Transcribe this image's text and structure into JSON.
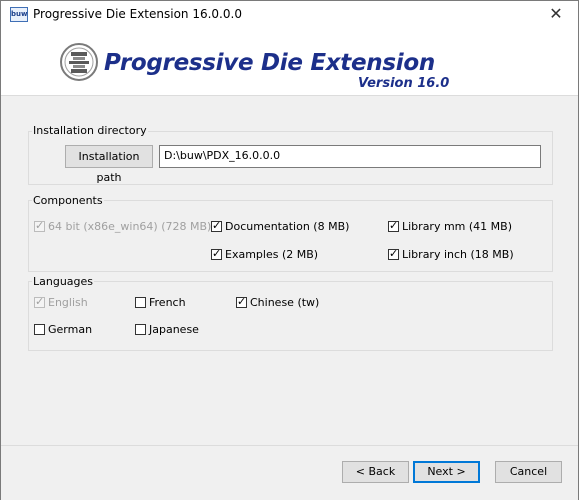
{
  "window": {
    "title": "Progressive Die Extension 16.0.0.0",
    "icon_text": "buw",
    "close_glyph": "✕"
  },
  "banner": {
    "title": "Progressive Die Extension",
    "version": "Version 16.0",
    "brand_color": "#1c2f8a"
  },
  "install": {
    "group_label": "Installation directory",
    "path_button": "Installation path",
    "path_value": "D:\\buw\\PDX_16.0.0.0"
  },
  "components": {
    "group_label": "Components",
    "items": [
      {
        "label": "64 bit (x86e_win64) (728 MB)",
        "checked": true,
        "disabled": true
      },
      {
        "label": "Documentation (8 MB)",
        "checked": true,
        "disabled": false
      },
      {
        "label": "Library mm (41 MB)",
        "checked": true,
        "disabled": false
      },
      {
        "label": "Examples (2 MB)",
        "checked": true,
        "disabled": false
      },
      {
        "label": "Library inch (18 MB)",
        "checked": true,
        "disabled": false
      }
    ]
  },
  "languages": {
    "group_label": "Languages",
    "items": [
      {
        "label": "English",
        "checked": true,
        "disabled": true
      },
      {
        "label": "French",
        "checked": false,
        "disabled": false
      },
      {
        "label": "Chinese (tw)",
        "checked": true,
        "disabled": false
      },
      {
        "label": "German",
        "checked": false,
        "disabled": false
      },
      {
        "label": "Japanese",
        "checked": false,
        "disabled": false
      }
    ]
  },
  "footer": {
    "back": "< Back",
    "next": "Next >",
    "cancel": "Cancel"
  }
}
